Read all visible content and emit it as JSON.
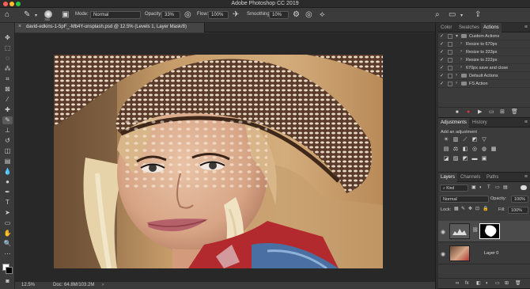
{
  "window": {
    "title": "Adobe Photoshop CC 2019"
  },
  "options_bar": {
    "brush_size": "700",
    "mode_label": "Mode:",
    "mode_value": "Normal",
    "opacity_label": "Opacity:",
    "opacity_value": "33%",
    "flow_label": "Flow:",
    "flow_value": "100%",
    "smoothing_label": "Smoothing:",
    "smoothing_value": "10%"
  },
  "document": {
    "tab_label": "david-edkins-1-5pF_-Mb4Y-unsplash.psd @ 12.5% (Levels 1, Layer Mask/8)",
    "close_glyph": "×"
  },
  "status": {
    "zoom": "12.5%",
    "doc_info": "Doc: 64.8M/103.2M"
  },
  "panels": {
    "top_tabs": [
      "Color",
      "Swatches",
      "Actions"
    ],
    "actions": [
      {
        "label": "Custom Actions",
        "check": "✓",
        "expanded": true,
        "level": 0
      },
      {
        "label": "Resize to 670px",
        "check": "✓",
        "level": 1
      },
      {
        "label": "Resize to 333px",
        "check": "✓",
        "level": 1
      },
      {
        "label": "Resize to 222px",
        "check": "✓",
        "level": 1
      },
      {
        "label": "670px save and close",
        "check": "✓",
        "level": 1
      },
      {
        "label": "Default Actions",
        "check": "✓",
        "level": 0
      },
      {
        "label": "FS Action",
        "check": "✓",
        "level": 0
      }
    ],
    "adjust_tabs": [
      "Adjustments",
      "History"
    ],
    "adjust_hint": "Add an adjustment",
    "layers_tabs": [
      "Layers",
      "Channels",
      "Paths"
    ],
    "layers": {
      "filter_kind": "Kind",
      "blend_mode": "Normal",
      "opacity_label": "Opacity:",
      "opacity_value": "100%",
      "lock_label": "Lock:",
      "fill_label": "Fill:",
      "fill_value": "100%",
      "items": [
        {
          "name": "",
          "type": "adjustment"
        },
        {
          "name": "Layer 0",
          "type": "image"
        }
      ],
      "footer_glyphs": [
        "∞",
        "fx",
        "◧",
        "◐",
        "▭",
        "⊞",
        "🗑"
      ]
    }
  },
  "colors": {
    "ui_dark": "#323232",
    "panel": "#3b3b3b",
    "selected_row": "#4b4b4b",
    "canvas_bg": "#282828"
  }
}
